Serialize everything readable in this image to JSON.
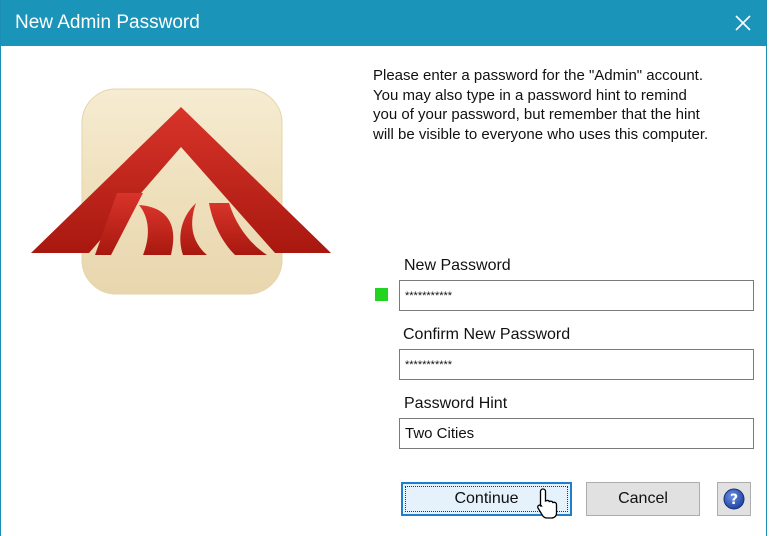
{
  "window": {
    "title": "New Admin Password",
    "close_icon": "close-icon"
  },
  "description": "Please enter a password for the \"Admin\" account.\nYou may also type in a password hint to remind\nyou of your password, but remember that the hint\nwill be visible to everyone who uses this computer.",
  "fields": {
    "new_password": {
      "label": "New Password",
      "value": "***********"
    },
    "confirm_password": {
      "label": "Confirm New Password",
      "value": "***********"
    },
    "hint": {
      "label": "Password Hint",
      "value": "Two Cities"
    }
  },
  "strength_indicator": {
    "color": "#22d41f"
  },
  "buttons": {
    "continue": "Continue",
    "cancel": "Cancel",
    "help_icon": "help-icon"
  },
  "logo": {
    "icon": "app-logo"
  },
  "colors": {
    "titlebar": "#1a94b8",
    "logo_red": "#c4261d",
    "accent_border": "#1e7fd1"
  }
}
